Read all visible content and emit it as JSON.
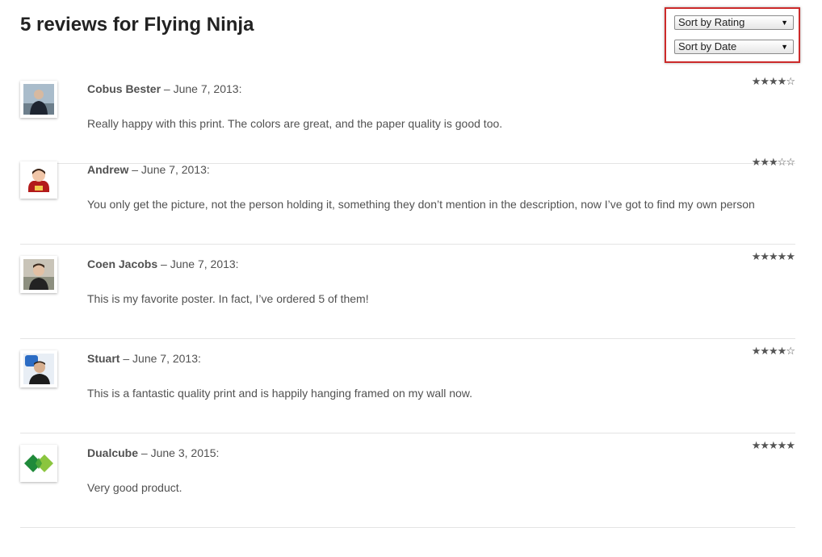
{
  "title": "5 reviews for Flying Ninja",
  "sort": {
    "rating_label": "Sort by Rating",
    "date_label": "Sort by Date",
    "arrow": "▼"
  },
  "reviews": [
    {
      "author": "Cobus Bester",
      "date": "June 7, 2013:",
      "separator": " – ",
      "text": "Really happy with this print. The colors are great, and the paper quality is good too.",
      "rating": 4,
      "stars": "★★★★☆",
      "avatar": "cobus-avatar"
    },
    {
      "author": "Andrew",
      "date": "June 7, 2013:",
      "separator": " – ",
      "text": "You only get the picture, not the person holding it, something they don’t mention in the description, now I’ve got to find my own person",
      "rating": 3,
      "stars": "★★★☆☆",
      "avatar": "andrew-avatar"
    },
    {
      "author": "Coen Jacobs",
      "date": "June 7, 2013:",
      "separator": " – ",
      "text": "This is my favorite poster. In fact, I’ve ordered 5 of them!",
      "rating": 5,
      "stars": "★★★★★",
      "avatar": "coen-avatar"
    },
    {
      "author": "Stuart",
      "date": "June 7, 2013:",
      "separator": " – ",
      "text": "This is a fantastic quality print and is happily hanging framed on my wall now.",
      "rating": 4,
      "stars": "★★★★☆",
      "avatar": "stuart-avatar"
    },
    {
      "author": "Dualcube",
      "date": "June 3, 2015:",
      "separator": " – ",
      "text": "Very good product.",
      "rating": 5,
      "stars": "★★★★★",
      "avatar": "dualcube-logo"
    }
  ],
  "colors": {
    "highlight_border": "#cc2a2a",
    "text": "#515151",
    "title": "#222222",
    "divider": "#e4e4e4"
  }
}
